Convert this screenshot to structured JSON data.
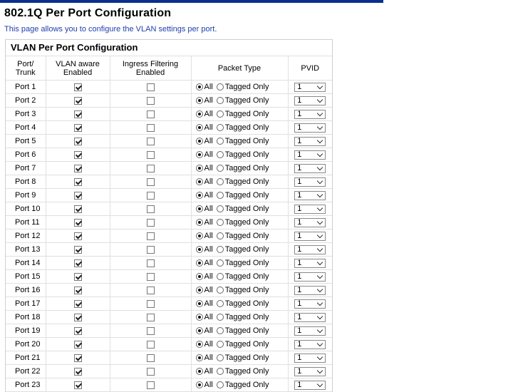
{
  "page": {
    "title": "802.1Q Per Port Configuration",
    "description": "This page allows you to configure the VLAN settings per port."
  },
  "panel": {
    "title": "VLAN Per Port Configuration",
    "headers": {
      "port": [
        "Port/",
        "Trunk"
      ],
      "vlan_aware": [
        "VLAN aware",
        "Enabled"
      ],
      "ingress": [
        "Ingress Filtering",
        "Enabled"
      ],
      "packet_type": "Packet Type",
      "pvid": "PVID"
    },
    "packet_type_options": {
      "all": "All",
      "tagged": "Tagged Only"
    },
    "rows": [
      {
        "port": "Port 1",
        "vlan_aware": true,
        "ingress": false,
        "packet_type": "All",
        "pvid": "1"
      },
      {
        "port": "Port 2",
        "vlan_aware": true,
        "ingress": false,
        "packet_type": "All",
        "pvid": "1"
      },
      {
        "port": "Port 3",
        "vlan_aware": true,
        "ingress": false,
        "packet_type": "All",
        "pvid": "1"
      },
      {
        "port": "Port 4",
        "vlan_aware": true,
        "ingress": false,
        "packet_type": "All",
        "pvid": "1"
      },
      {
        "port": "Port 5",
        "vlan_aware": true,
        "ingress": false,
        "packet_type": "All",
        "pvid": "1"
      },
      {
        "port": "Port 6",
        "vlan_aware": true,
        "ingress": false,
        "packet_type": "All",
        "pvid": "1"
      },
      {
        "port": "Port 7",
        "vlan_aware": true,
        "ingress": false,
        "packet_type": "All",
        "pvid": "1"
      },
      {
        "port": "Port 8",
        "vlan_aware": true,
        "ingress": false,
        "packet_type": "All",
        "pvid": "1"
      },
      {
        "port": "Port 9",
        "vlan_aware": true,
        "ingress": false,
        "packet_type": "All",
        "pvid": "1"
      },
      {
        "port": "Port 10",
        "vlan_aware": true,
        "ingress": false,
        "packet_type": "All",
        "pvid": "1"
      },
      {
        "port": "Port 11",
        "vlan_aware": true,
        "ingress": false,
        "packet_type": "All",
        "pvid": "1"
      },
      {
        "port": "Port 12",
        "vlan_aware": true,
        "ingress": false,
        "packet_type": "All",
        "pvid": "1"
      },
      {
        "port": "Port 13",
        "vlan_aware": true,
        "ingress": false,
        "packet_type": "All",
        "pvid": "1"
      },
      {
        "port": "Port 14",
        "vlan_aware": true,
        "ingress": false,
        "packet_type": "All",
        "pvid": "1"
      },
      {
        "port": "Port 15",
        "vlan_aware": true,
        "ingress": false,
        "packet_type": "All",
        "pvid": "1"
      },
      {
        "port": "Port 16",
        "vlan_aware": true,
        "ingress": false,
        "packet_type": "All",
        "pvid": "1"
      },
      {
        "port": "Port 17",
        "vlan_aware": true,
        "ingress": false,
        "packet_type": "All",
        "pvid": "1"
      },
      {
        "port": "Port 18",
        "vlan_aware": true,
        "ingress": false,
        "packet_type": "All",
        "pvid": "1"
      },
      {
        "port": "Port 19",
        "vlan_aware": true,
        "ingress": false,
        "packet_type": "All",
        "pvid": "1"
      },
      {
        "port": "Port 20",
        "vlan_aware": true,
        "ingress": false,
        "packet_type": "All",
        "pvid": "1"
      },
      {
        "port": "Port 21",
        "vlan_aware": true,
        "ingress": false,
        "packet_type": "All",
        "pvid": "1"
      },
      {
        "port": "Port 22",
        "vlan_aware": true,
        "ingress": false,
        "packet_type": "All",
        "pvid": "1"
      },
      {
        "port": "Port 23",
        "vlan_aware": true,
        "ingress": false,
        "packet_type": "All",
        "pvid": "1"
      }
    ]
  }
}
